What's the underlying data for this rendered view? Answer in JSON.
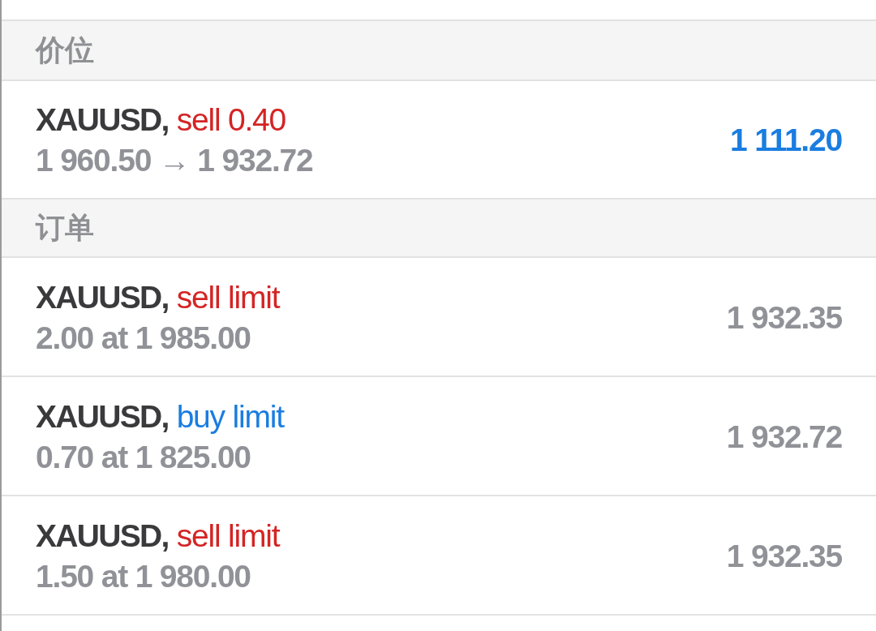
{
  "sections": [
    {
      "title": "价位",
      "items": [
        {
          "kind": "position",
          "symbol": "XAUUSD,",
          "action": {
            "text": "sell 0.40",
            "color": "#d42424"
          },
          "detail": "1 960.50 → 1 932.72",
          "value": "1 111.20"
        }
      ]
    },
    {
      "title": "订单",
      "items": [
        {
          "kind": "order",
          "symbol": "XAUUSD,",
          "action": {
            "text": "sell limit",
            "color": "#d42424"
          },
          "detail": "2.00 at 1 985.00",
          "value": "1 932.35"
        },
        {
          "kind": "order",
          "symbol": "XAUUSD,",
          "action": {
            "text": "buy limit",
            "color": "#1a7de0"
          },
          "detail": "0.70 at 1 825.00",
          "value": "1 932.72"
        },
        {
          "kind": "order",
          "symbol": "XAUUSD,",
          "action": {
            "text": "sell limit",
            "color": "#d42424"
          },
          "detail": "1.50 at 1 980.00",
          "value": "1 932.35"
        }
      ]
    }
  ]
}
